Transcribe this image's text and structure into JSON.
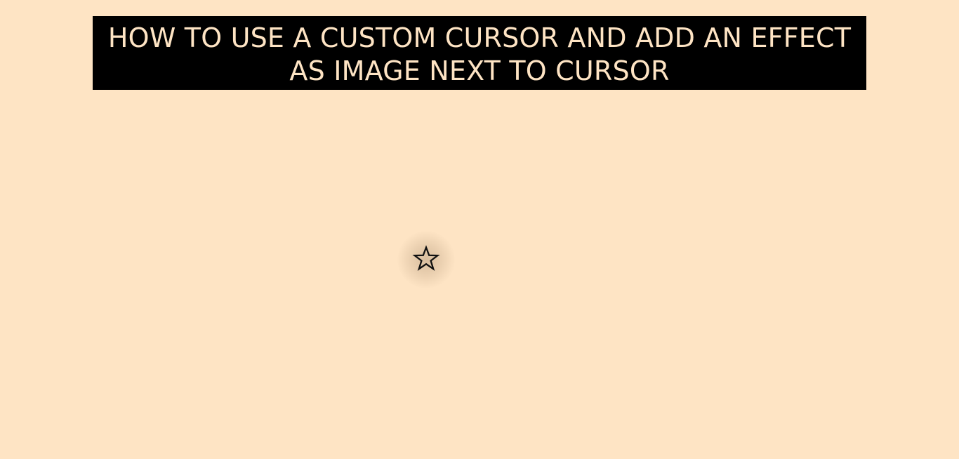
{
  "page": {
    "background_color": "#FEE4C4"
  },
  "header": {
    "title_line_1": "HOW TO USE A CUSTOM CURSOR AND ADD AN EFFECT",
    "title_line_2": "AS IMAGE NEXT TO CURSOR",
    "background_color": "#000000",
    "text_color": "#FEE4C4"
  },
  "cursor": {
    "icon": "star-outline-icon",
    "glyph": "☆",
    "color": "#111111",
    "effect": "radial-glow"
  }
}
